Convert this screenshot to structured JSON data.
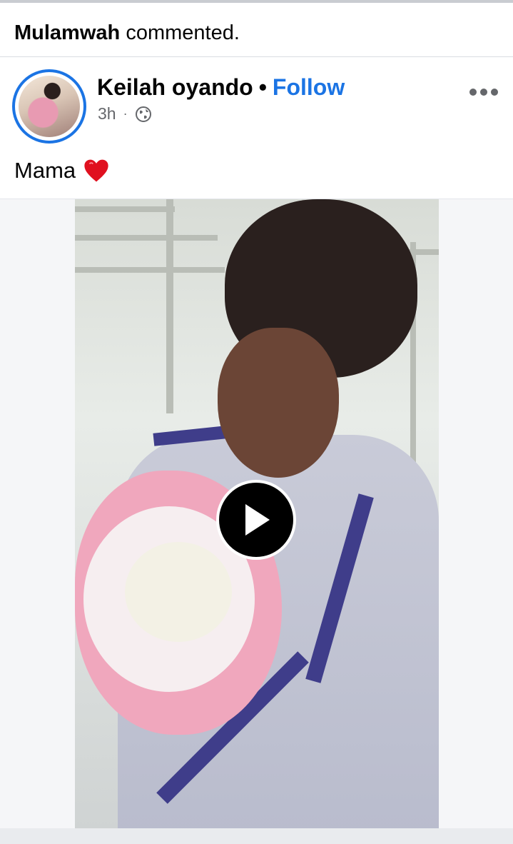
{
  "activity": {
    "actor": "Mulamwah",
    "action": "commented."
  },
  "post": {
    "author": "Keilah oyando",
    "separator": "•",
    "follow_label": "Follow",
    "time": "3h",
    "meta_separator": "·",
    "privacy_icon": "globe-icon",
    "caption": "Mama",
    "caption_emoji": "heart-icon",
    "more_icon": "more-options-icon",
    "media_type": "video",
    "play_icon": "play-icon"
  },
  "colors": {
    "link_blue": "#1b74e4",
    "text_primary": "#050505",
    "text_secondary": "#65676b",
    "heart_red": "#e0101f"
  }
}
